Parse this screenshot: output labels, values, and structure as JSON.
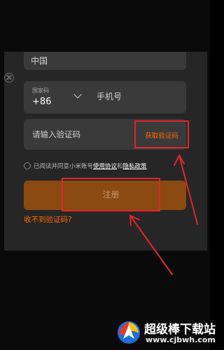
{
  "form": {
    "partial_field_text": "中国",
    "country_label": "国家码",
    "country_code": "+86",
    "phone_placeholder": "手机号",
    "code_placeholder": "请输入验证码",
    "get_code_label": "获取验证码",
    "agree_prefix": "已阅读并同意小米账号",
    "agree_terms": "使用协议",
    "agree_and": "和",
    "agree_privacy": "隐私政策",
    "register_label": "注册",
    "no_code_label": "收不到验证码?"
  },
  "watermark": {
    "name": "超级棒下载站",
    "url": "www.cjbwh.com"
  },
  "icons": [
    "close-icon",
    "chevron-down-icon",
    "checkbox-icon",
    "brand-logo-icon"
  ],
  "colors": {
    "accent_orange": "#ff6a00",
    "register_button": "#8a4a12",
    "highlight_red": "#e3262a",
    "background": "#262626"
  }
}
